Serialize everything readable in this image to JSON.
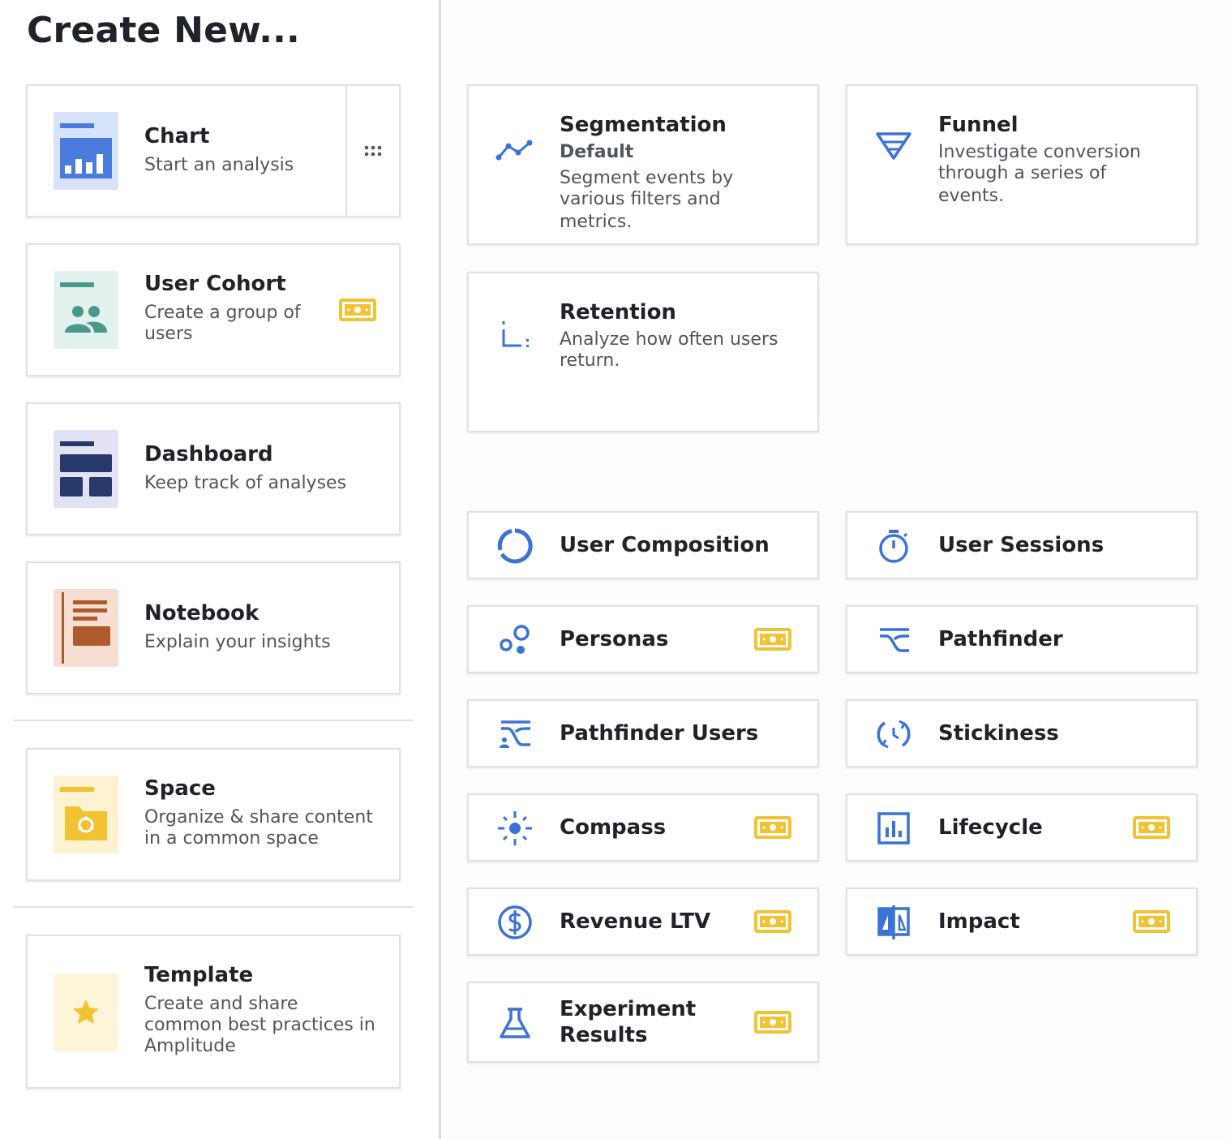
{
  "header": {
    "title": "Create New..."
  },
  "left_cards": {
    "chart": {
      "title": "Chart",
      "desc": "Start an analysis",
      "more_icon": "more-dots-icon"
    },
    "cohort": {
      "title": "User Cohort",
      "desc_line1": "Create a group of",
      "desc_line2": "users",
      "badge_icon": "paid-feature-icon"
    },
    "dashboard": {
      "title": "Dashboard",
      "desc": "Keep track of analyses"
    },
    "notebook": {
      "title": "Notebook",
      "desc": "Explain your insights"
    },
    "space": {
      "title": "Space",
      "desc_line1": "Organize & share content",
      "desc_line2": "in a common space"
    },
    "template": {
      "title": "Template",
      "desc_line1": "Create and share",
      "desc_line2": "common best practices in",
      "desc_line3": "Amplitude"
    }
  },
  "right_cards": {
    "segmentation": {
      "title": "Segmentation",
      "subtitle": "Default",
      "desc_line1": "Segment events by",
      "desc_line2": "various filters and metrics."
    },
    "funnel": {
      "title": "Funnel",
      "desc_line1": "Investigate conversion",
      "desc_line2": "through a series of events."
    },
    "retention": {
      "title": "Retention",
      "desc_line1": "Analyze how often users",
      "desc_line2": "return."
    },
    "user_composition": {
      "title": "User Composition"
    },
    "user_sessions": {
      "title": "User Sessions"
    },
    "personas": {
      "title": "Personas"
    },
    "pathfinder": {
      "title": "Pathfinder"
    },
    "pathfinder_users": {
      "title": "Pathfinder Users"
    },
    "stickiness": {
      "title": "Stickiness"
    },
    "compass": {
      "title": "Compass"
    },
    "lifecycle": {
      "title": "Lifecycle"
    },
    "revenue_ltv": {
      "title": "Revenue LTV"
    },
    "impact": {
      "title": "Impact"
    },
    "experiment_results": {
      "title_line1": "Experiment",
      "title_line2": "Results"
    }
  },
  "colors": {
    "accent_blue": "#3a72d6",
    "paid_yellow": "#f1c232",
    "chart_tile": "#d7e3fa",
    "cohort_tile": "#e3f2ef",
    "dashboard_tile": "#e2e2f4",
    "notebook_tile": "#f6dfd2",
    "space_tile": "#fdf3d2",
    "template_tile": "#fdf5d9"
  }
}
